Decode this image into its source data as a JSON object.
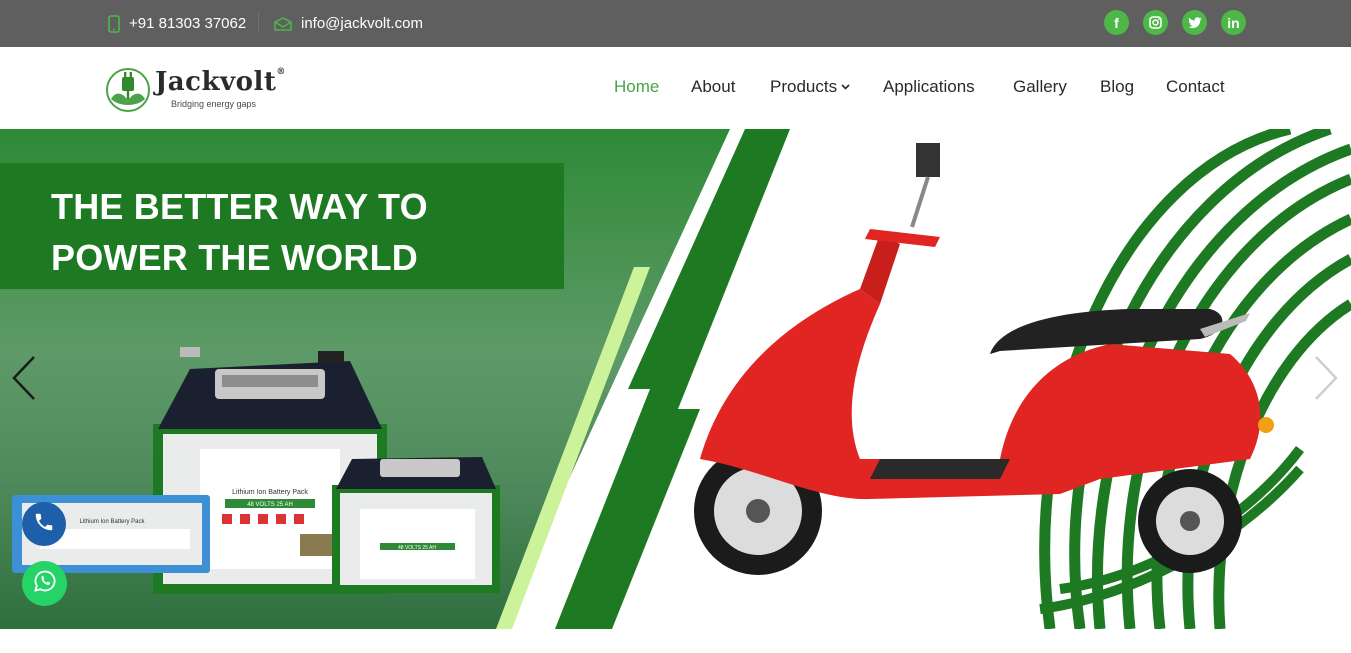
{
  "topbar": {
    "phone": "+91 81303 37062",
    "email": "info@jackvolt.com",
    "social": [
      {
        "icon": "facebook-icon",
        "glyph": "f"
      },
      {
        "icon": "instagram-icon",
        "glyph": ""
      },
      {
        "icon": "twitter-icon",
        "glyph": ""
      },
      {
        "icon": "linkedin-icon",
        "glyph": "in"
      }
    ]
  },
  "header": {
    "logo_name": "Jackvolt",
    "logo_reg": "®",
    "logo_tagline": "Bridging energy gaps",
    "nav": {
      "home": "Home",
      "about": "About",
      "products": "Products",
      "applications": "Applications",
      "gallery": "Gallery",
      "blog": "Blog",
      "contact": "Contact"
    }
  },
  "hero": {
    "headline_line1": "THE BETTER WAY TO",
    "headline_line2": "POWER THE WORLD",
    "battery_large_label": "Lithium Ion Battery Pack",
    "battery_large_spec": "48 VOLTS 25 AH",
    "battery_small_spec": "48 VOLTS 25 AH",
    "battery_blue_label": "Lithium Ion Battery Pack"
  },
  "colors": {
    "accent": "#4aa348",
    "brand_green": "#1e7a22",
    "topbar": "#5f5f5f",
    "light_green": "#ccf29a"
  }
}
